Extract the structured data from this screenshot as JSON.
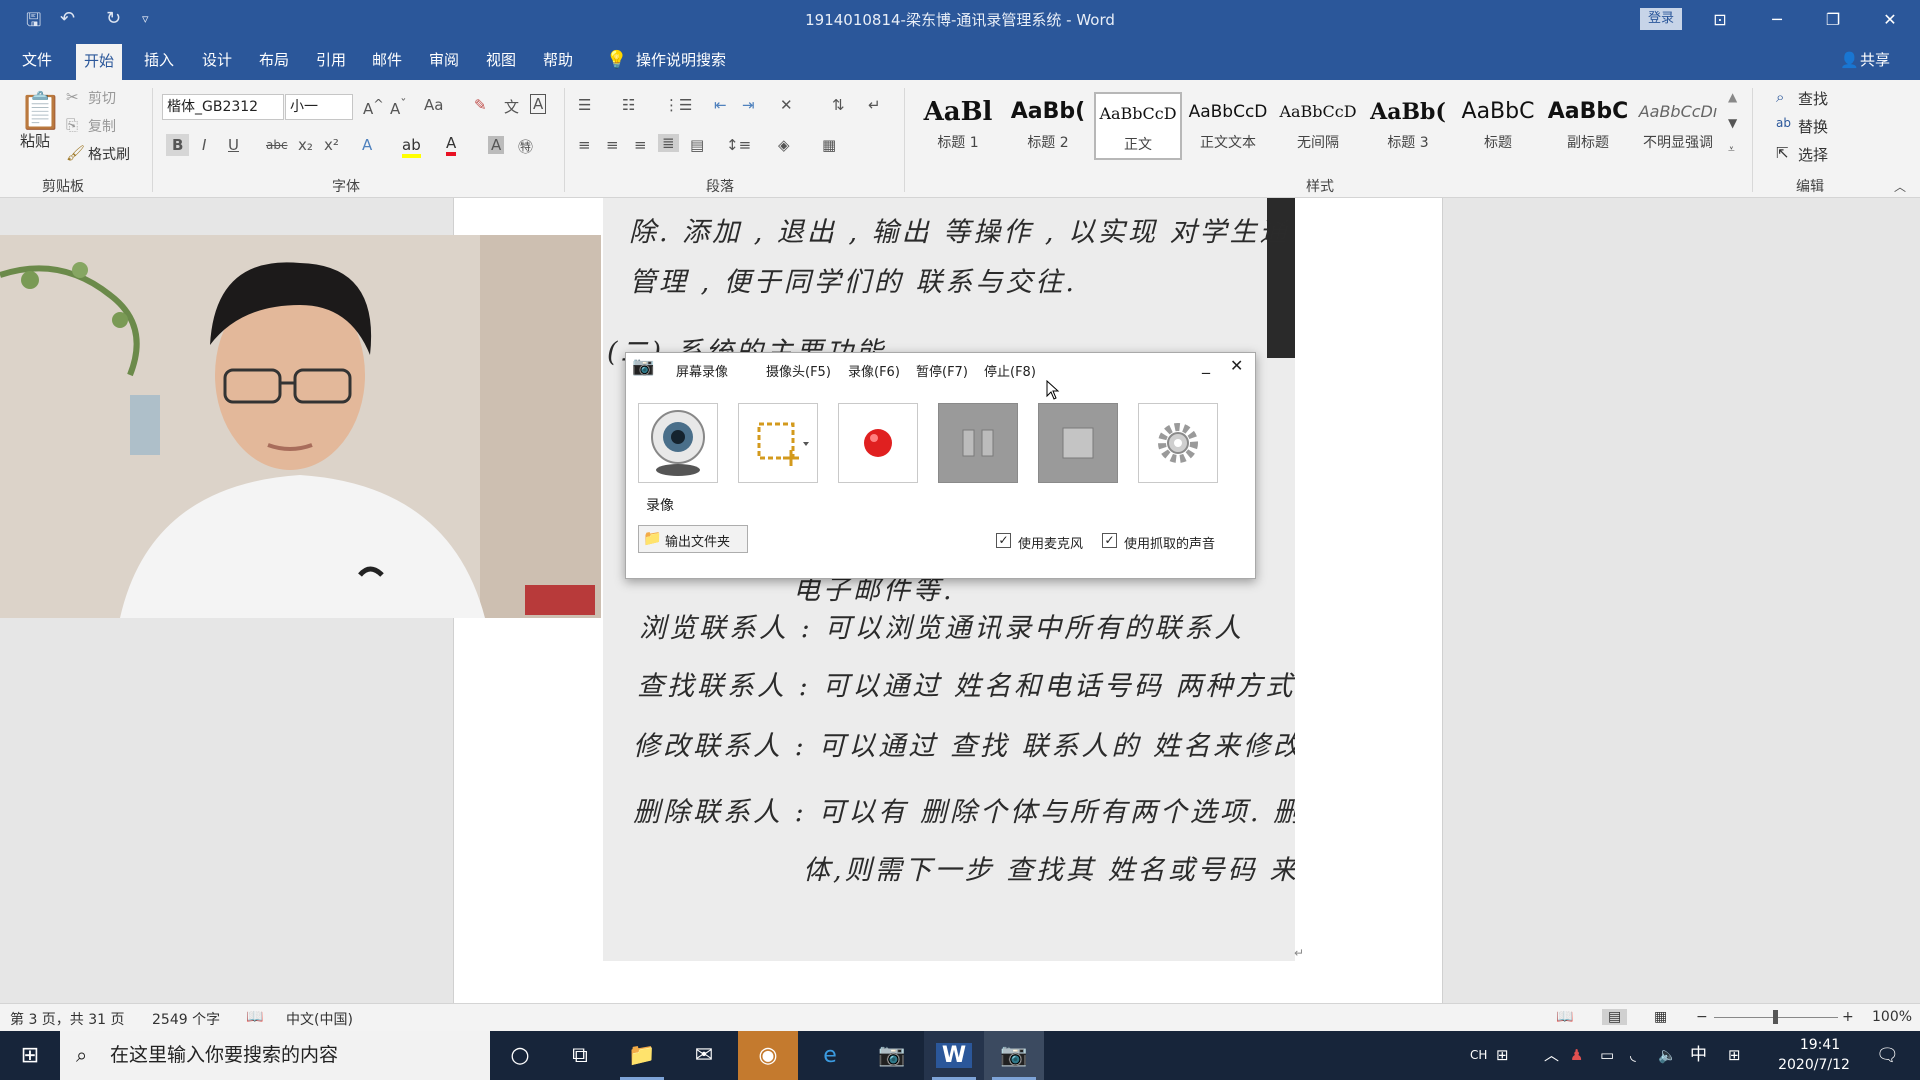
{
  "window": {
    "title": "1914010814-梁东博-通讯录管理系统  -  Word",
    "login_label": "登录",
    "qa_save_icon": "save-icon",
    "qa_undo_icon": "undo-icon",
    "qa_redo_icon": "redo-icon"
  },
  "tabs": [
    "文件",
    "开始",
    "插入",
    "设计",
    "布局",
    "引用",
    "邮件",
    "审阅",
    "视图",
    "帮助"
  ],
  "tell_me": "操作说明搜索",
  "share": "共享",
  "ribbon": {
    "clipboard": {
      "paste": "粘贴",
      "cut": "剪切",
      "copy": "复制",
      "format_painter": "格式刷",
      "label": "剪贴板"
    },
    "font": {
      "name": "楷体_GB2312",
      "size": "小一",
      "case_label": "Aa",
      "label": "字体"
    },
    "paragraph": {
      "label": "段落"
    },
    "styles": {
      "label": "样式",
      "items": [
        {
          "sample": "AaBl",
          "name": "标题 1"
        },
        {
          "sample": "AaBb(",
          "name": "标题 2"
        },
        {
          "sample": "AaBbCcD",
          "name": "正文"
        },
        {
          "sample": "AaBbCcD",
          "name": "正文文本"
        },
        {
          "sample": "AaBbCcD",
          "name": "无间隔"
        },
        {
          "sample": "AaBb(",
          "name": "标题 3"
        },
        {
          "sample": "AaBbC",
          "name": "标题"
        },
        {
          "sample": "AaBbC",
          "name": "副标题"
        },
        {
          "sample": "AaBbCcDı",
          "name": "不明显强调"
        }
      ]
    },
    "editing": {
      "find": "查找",
      "replace": "替换",
      "select": "选择",
      "label": "编辑"
    }
  },
  "document": {
    "handwriting": [
      "除. 添加 , 退出 , 输出 等操作 , 以实现 对学生通迅录信息的",
      "管理 , 便于同学们的 联系与交往.",
      "(二) 系统的主要功能",
      "电子邮件等.",
      "浏览联系人 :   可以浏览通讯录中所有的联系人",
      "查找联系人 :   可以通过 姓名和电话号码 两种方式来查找.",
      "修改联系人 :   可以通过 查找 联系人的 姓名来修改其信息",
      "删除联系人 :   可以有 删除个体与所有两个选项.  删除个",
      "体,则需下一步 查找其 姓名或号码 来进行删除"
    ]
  },
  "recorder": {
    "title": "屏幕录像",
    "menu": [
      "摄像头(F5)",
      "录像(F6)",
      "暂停(F7)",
      "停止(F8)"
    ],
    "buttons": [
      "webcam-icon",
      "region-select-icon",
      "record-icon",
      "pause-icon",
      "stop-icon",
      "settings-icon"
    ],
    "record_label": "录像",
    "output_folder": "输出文件夹",
    "use_mic": "使用麦克风",
    "use_captured_audio": "使用抓取的声音",
    "use_mic_checked": true,
    "use_captured_audio_checked": true
  },
  "status": {
    "page": "第 3 页，共 31 页",
    "words": "2549 个字",
    "language": "中文(中国)",
    "zoom": "100%"
  },
  "taskbar": {
    "search_placeholder": "在这里输入你要搜索的内容",
    "ime_mode": "CH",
    "ime_lang": "中",
    "time": "19:41",
    "date": "2020/7/12"
  }
}
